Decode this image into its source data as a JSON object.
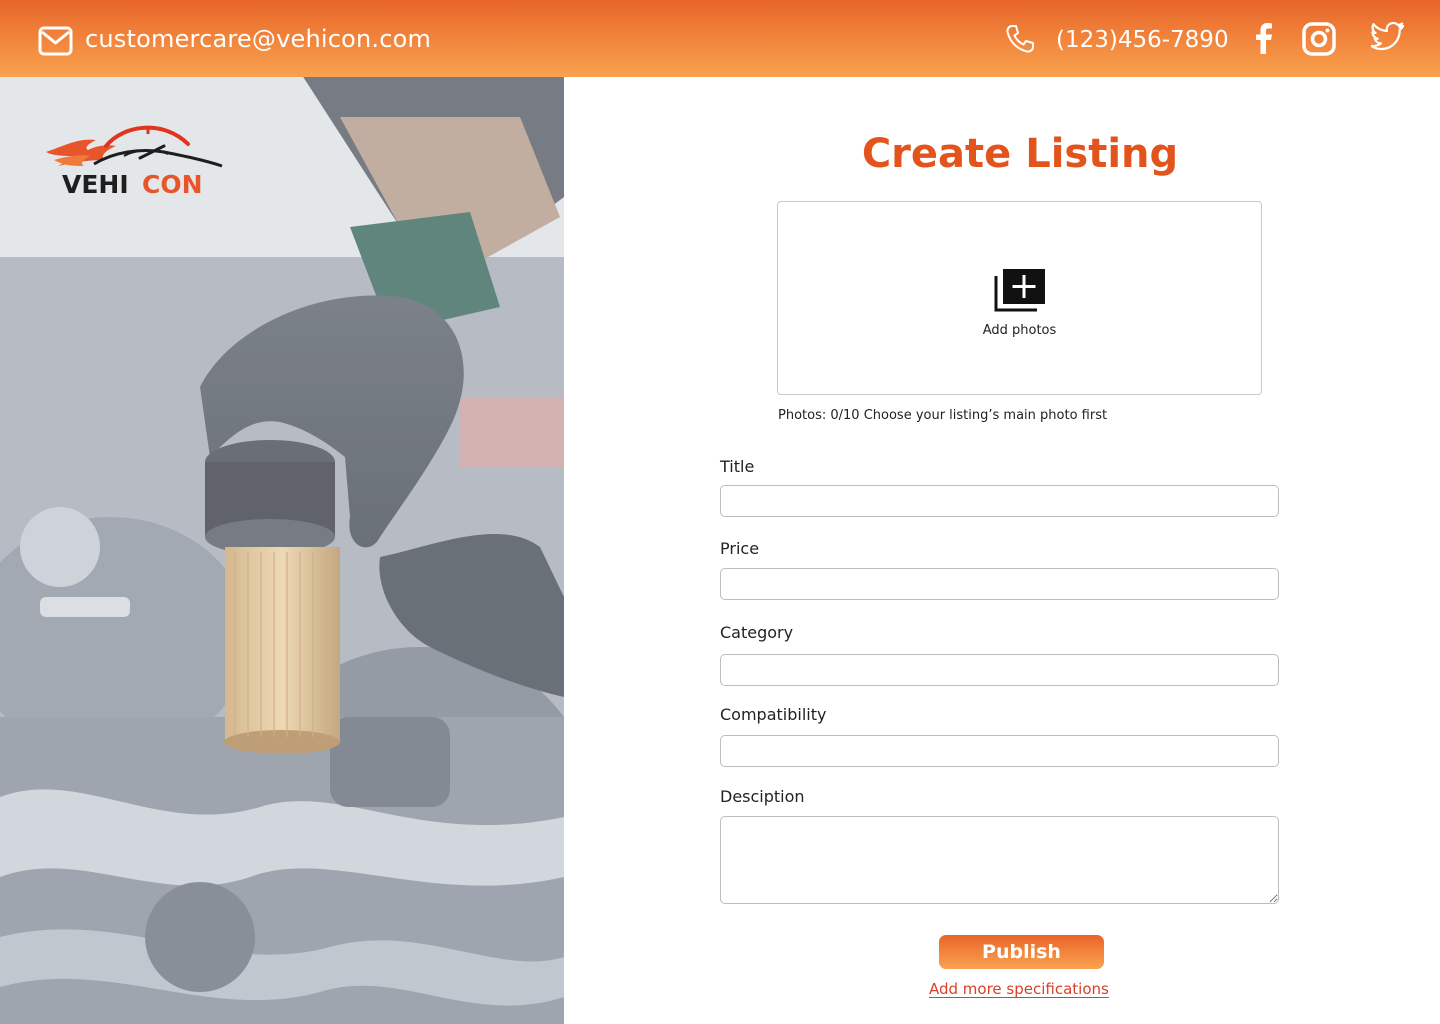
{
  "header": {
    "email": "customercare@vehicon.com",
    "phone": "(123)456-7890",
    "icons": [
      "mail-icon",
      "phone-icon",
      "facebook-icon",
      "instagram-icon",
      "twitter-icon"
    ]
  },
  "brand": {
    "logo_text_1": "VEHI",
    "logo_text_2": "CON"
  },
  "form": {
    "title": "Create Listing",
    "photos": {
      "add_label": "Add photos",
      "hint": "Photos: 0/10 Choose your listing’s main photo first"
    },
    "fields": [
      {
        "label": "Title",
        "value": ""
      },
      {
        "label": "Price",
        "value": ""
      },
      {
        "label": "Category",
        "value": ""
      },
      {
        "label": "Compatibility",
        "value": ""
      },
      {
        "label": "Desciption",
        "value": ""
      }
    ],
    "publish_label": "Publish",
    "more_link": "Add more specifications"
  },
  "colors": {
    "accent": "#e2541b",
    "header_gradient_start": "#e8652a",
    "header_gradient_end": "#f8a24f",
    "link": "#d8412a"
  }
}
